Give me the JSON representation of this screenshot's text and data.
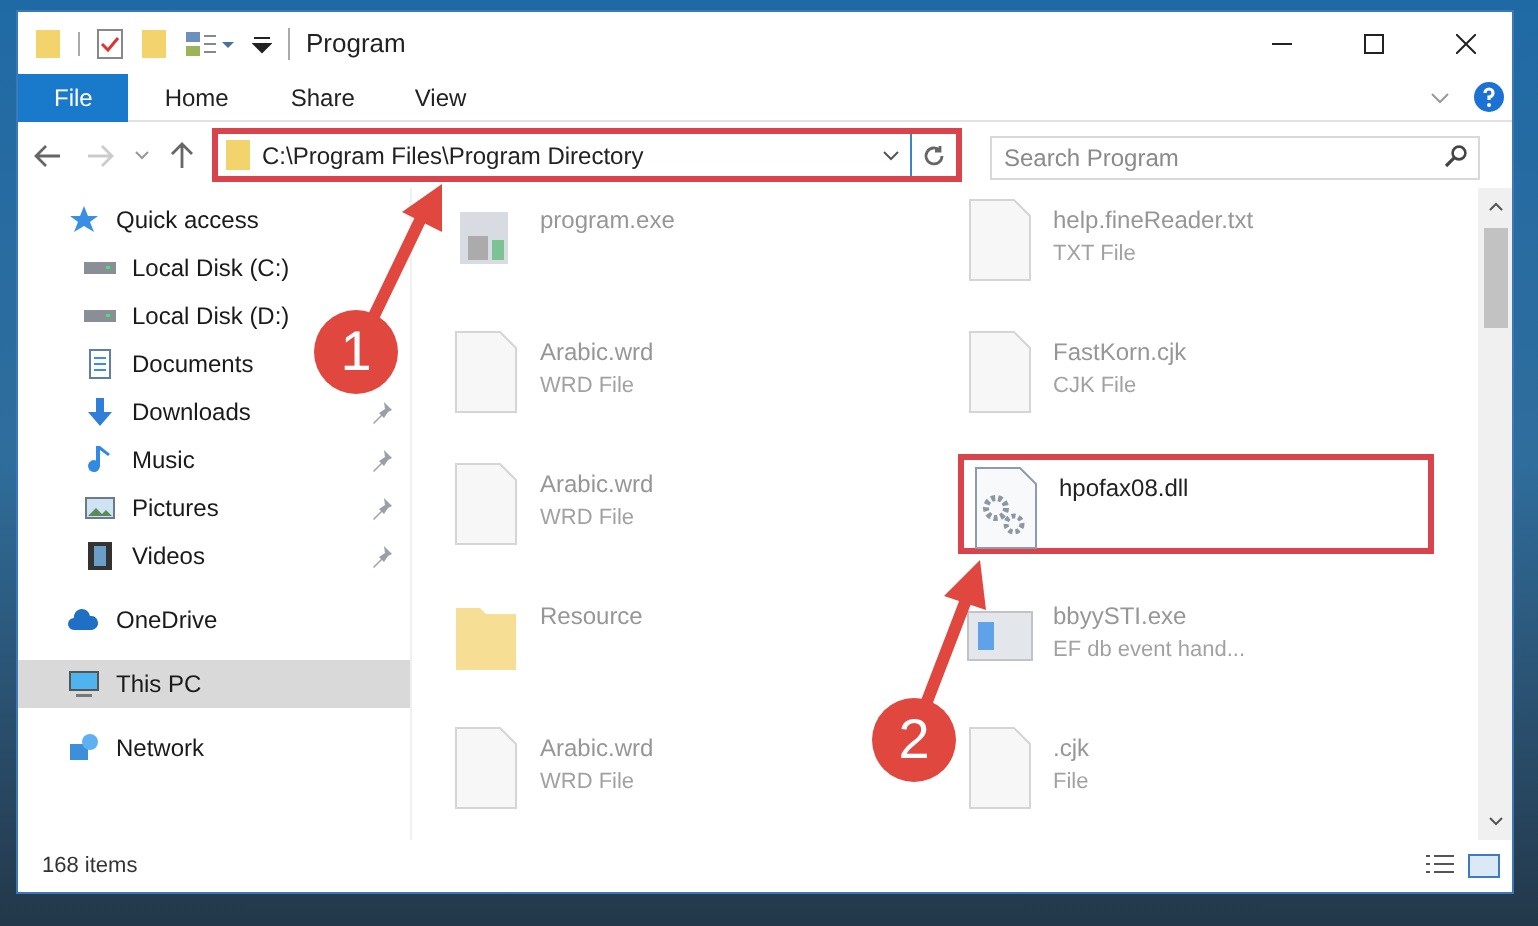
{
  "window": {
    "title": "Program"
  },
  "ribbon_tabs": [
    {
      "label": "File",
      "selected": true
    },
    {
      "label": "Home",
      "selected": false
    },
    {
      "label": "Share",
      "selected": false
    },
    {
      "label": "View",
      "selected": false
    }
  ],
  "address_bar": {
    "path": "C:\\Program Files\\Program Directory",
    "highlighted": true
  },
  "search": {
    "placeholder": "Search Program"
  },
  "sidebar": {
    "items": [
      {
        "label": "Quick access",
        "kind": "star",
        "pinned": false,
        "selected": false,
        "children": [
          {
            "label": "Local Disk (C:)",
            "kind": "disk",
            "pinned": false,
            "selected": false
          },
          {
            "label": "Local Disk (D:)",
            "kind": "disk",
            "pinned": false,
            "selected": false
          },
          {
            "label": "Documents",
            "kind": "docs",
            "pinned": false,
            "selected": false
          },
          {
            "label": "Downloads",
            "kind": "download",
            "pinned": true,
            "selected": false
          },
          {
            "label": "Music",
            "kind": "music",
            "pinned": true,
            "selected": false
          },
          {
            "label": "Pictures",
            "kind": "pictures",
            "pinned": true,
            "selected": false
          },
          {
            "label": "Videos",
            "kind": "videos",
            "pinned": true,
            "selected": false
          }
        ]
      },
      {
        "label": "OneDrive",
        "kind": "cloud",
        "pinned": false,
        "selected": false
      },
      {
        "label": "This PC",
        "kind": "pc",
        "pinned": false,
        "selected": true
      },
      {
        "label": "Network",
        "kind": "network",
        "pinned": false,
        "selected": false
      }
    ]
  },
  "files": [
    {
      "name": "program.exe",
      "kind": "exe",
      "highlighted": false
    },
    {
      "name": "help.fineReader.txt",
      "type": "TXT File",
      "kind": "doc",
      "highlighted": false
    },
    {
      "name": "Arabic.wrd",
      "type": "WRD File",
      "kind": "doc",
      "highlighted": false
    },
    {
      "name": "FastKorn.cjk",
      "type": "CJK File",
      "kind": "doc",
      "highlighted": false
    },
    {
      "name": "Arabic.wrd",
      "type": "WRD File",
      "kind": "doc",
      "highlighted": false
    },
    {
      "name": "hpofax08.dll",
      "kind": "dll",
      "highlighted": true
    },
    {
      "name": "Resource",
      "kind": "folder",
      "highlighted": false
    },
    {
      "name": "bbyySTI.exe",
      "type": "EF db event hand...",
      "kind": "app",
      "highlighted": false
    },
    {
      "name": "Arabic.wrd",
      "type": "WRD File",
      "kind": "doc",
      "highlighted": false
    },
    {
      "name": ".cjk",
      "type": "File",
      "kind": "doc",
      "highlighted": false
    }
  ],
  "status_bar": {
    "item_count": "168 items"
  },
  "annotations": [
    {
      "number": "1"
    },
    {
      "number": "2"
    }
  ]
}
